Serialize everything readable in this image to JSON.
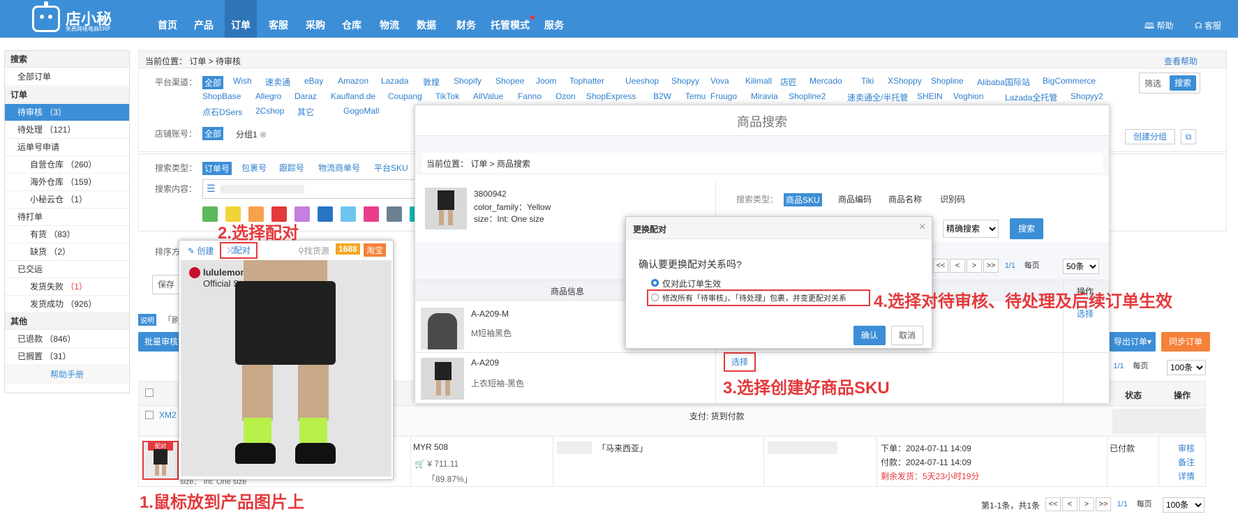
{
  "logo": {
    "name": "店小秘",
    "sub": "免费跨境电商ERP"
  },
  "nav": [
    "首页",
    "产品",
    "订单",
    "客服",
    "采购",
    "仓库",
    "物流",
    "数据",
    "财务",
    "托管模式",
    "服务"
  ],
  "top_right": {
    "help": "帮助",
    "service": "客服"
  },
  "sidebar": {
    "search": "搜索",
    "all_orders": "全部订单",
    "orders": "订单",
    "pending_review": "待审核 （3）",
    "pending_process": "待处理 （121）",
    "tracking_apply": "运单号申请",
    "self_wh": "自营仓库 （260）",
    "overseas_wh": "海外仓库 （159）",
    "xiaomi_cloud": "小秘云仓 （1）",
    "to_print": "待打单",
    "in_stock": "有货 （83）",
    "out_stock": "缺货 （2）",
    "shipped": "已交运",
    "ship_fail": "发货失败",
    "ship_fail_count": "（1）",
    "ship_ok": "发货成功 （926）",
    "other": "其他",
    "refunded": "已退款 （846）",
    "shelved": "已搁置 （31）",
    "help_manual": "帮助手册"
  },
  "breadcrumb": "当前位置： 订单 > 待审核",
  "view_help": "查看帮助",
  "platform_label": "平台渠道：",
  "platforms_row1": [
    "全部",
    "Wish",
    "速卖通",
    "eBay",
    "Amazon",
    "Lazada",
    "敦煌",
    "Shopify",
    "Shopee",
    "Joom",
    "Tophatter",
    "Ueeshop",
    "Shopyy",
    "Vova",
    "Kilimall",
    "店匠",
    "Mercado",
    "Tiki",
    "XShoppy",
    "Shopline",
    "Alibaba国际站",
    "BigCommerce"
  ],
  "platforms_row2": [
    "ShopBase",
    "Allegro",
    "Daraz",
    "Kaufland.de",
    "Coupang",
    "TikTok",
    "AllValue",
    "Fanno",
    "Ozon",
    "ShopExpress",
    "B2W",
    "Temu",
    "Fruugo",
    "Miravia",
    "Shopline2",
    "速卖通全/半托管",
    "SHEIN",
    "Voghion",
    "Lazada全托管",
    "Shopyy2"
  ],
  "platforms_row3": [
    "点石DSers",
    "2Cshop",
    "其它",
    "GogoMall"
  ],
  "filter_btn": "筛选",
  "search_btn": "搜索",
  "shop_label": "店铺账号：",
  "shop_all": "全部",
  "shop_group": "分组1",
  "create_group": "创建分组",
  "search_type_label": "搜索类型：",
  "search_types": [
    "订单号",
    "包裹号",
    "跟踪号",
    "物流商单号",
    "平台SKU"
  ],
  "search_content_label": "搜索内容：",
  "sort_label": "排序方",
  "save_btn": "保存",
  "tip_label": "说明",
  "tip_text": "「刷",
  "batch_review": "批量审核",
  "export_btn": "导出订单",
  "sync_btn": "同步订单",
  "pager_top": {
    "page": "1/1",
    "per": "每页",
    "size": "100条"
  },
  "table": {
    "status": "状态",
    "action": "操作"
  },
  "order": {
    "id": "XM2",
    "pay": "支付: 货到付款",
    "price": "MYR 508",
    "cny": "¥ 711.11",
    "pct": "「89.87%」",
    "region": "「马来西亚」",
    "order_time": "下单：2024-07-11 14:09",
    "pay_time": "付款：2024-07-11 14:09",
    "remain": "剩余发货：5天23小时19分",
    "status": "已付款",
    "actions": [
      "审核",
      "备注",
      "详情"
    ],
    "size_text": "size： Int: One size"
  },
  "pager_bottom": {
    "summary": "第1-1条，共1条",
    "page": "1/1",
    "per": "每页",
    "size": "100条"
  },
  "popup": {
    "create": "创建",
    "match": "配对",
    "find_source": "找货源",
    "tag1688": "1688",
    "taobao": "淘宝",
    "brand": "lululemon",
    "store": "Official Store",
    "match_tag": "配对"
  },
  "prod_search": {
    "title": "商品搜索",
    "breadcrumb": "当前位置： 订单 > 商品搜索",
    "item": {
      "id": "3800942",
      "color": "color_family：Yellow",
      "size": "size：Int: One size"
    },
    "search_type_label": "搜索类型：",
    "search_types": [
      "商品SKU",
      "商品编码",
      "商品名称",
      "识别码"
    ],
    "mode": "精确搜索",
    "search_btn": "搜索",
    "pager": {
      "page": "1/1",
      "per": "每页",
      "size": "50条"
    },
    "col_info": "商品信息",
    "col_op": "操作",
    "rows": [
      {
        "sku": "A-A209-M",
        "name": "M短袖黑色",
        "action": "选择"
      },
      {
        "sku": "A-A209",
        "name": "上衣短袖-黑色",
        "action": "选择"
      }
    ]
  },
  "confirm": {
    "title": "更换配对",
    "close": "×",
    "question": "确认要更换配对关系吗?",
    "opt1": "仅对此订单生效",
    "opt2": "修改所有「待审核」、「待处理」包裹，并变更配对关系",
    "ok": "确认",
    "cancel": "取消"
  },
  "annotations": {
    "a1": "1.鼠标放到产品图片上",
    "a2": "2.选择配对",
    "a3": "3.选择创建好商品SKU",
    "a4": "4.选择对待审核、待处理及后续订单生效"
  },
  "colors": {
    "primary": "#3c8ed6",
    "orange": "#f5813a",
    "red": "#e4393c"
  }
}
